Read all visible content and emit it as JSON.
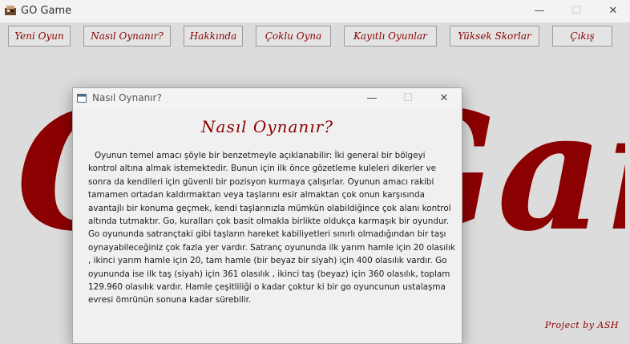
{
  "window": {
    "title": "GO Game",
    "controls": {
      "minimize": "—",
      "maximize": "☐",
      "close": "✕"
    }
  },
  "toolbar": {
    "buttons": [
      "Yeni Oyun",
      "Nasıl Oynanır?",
      "Hakkında",
      "Çoklu Oyna",
      "Kayıtlı Oyunlar",
      "Yüksek Skorlar",
      "Çıkış"
    ]
  },
  "background": {
    "logo_text": "GO Game",
    "logo_color": "#8b0000",
    "credit": "Project by ASH"
  },
  "dialog": {
    "title": "Nasıl Oynanır?",
    "heading": "Nasıl Oynanır?",
    "body": "Oyunun temel amacı şöyle bir benzetmeyle açıklanabilir: İki general bir bölgeyi kontrol altına almak istemektedir. Bunun için ilk önce gözetleme kuleleri dikerler ve sonra da kendileri için güvenli bir pozisyon kurmaya çalışırlar. Oyunun amacı rakibi tamamen ortadan kaldırmaktan veya taşlarını esir almaktan çok onun karşısında avantajlı bir konuma geçmek, kendi taşlarınızla mümkün olabildiğince çok alanı kontrol altında tutmaktır. Go, kuralları çok basit olmakla birlikte oldukça karmaşık bir oyundur. Go oyununda satrançtaki gibi taşların hareket kabiliyetleri sınırlı olmadığından bir taşı oynayabileceğiniz çok fazla yer vardır. Satranç oyununda ilk yarım hamle için 20 olasılık , ikinci yarım hamle için 20, tam hamle (bir beyaz bir siyah) için 400 olasılık vardır. Go oyununda ise ilk taş (siyah) için 361 olasılık , ikinci taş (beyaz) için 360 olasılık, toplam 129.960 olasılık vardır. Hamle çeşitliliği o kadar çoktur ki bir go oyuncunun ustalaşma evresi ömrünün sonuna kadar sürebilir."
  }
}
